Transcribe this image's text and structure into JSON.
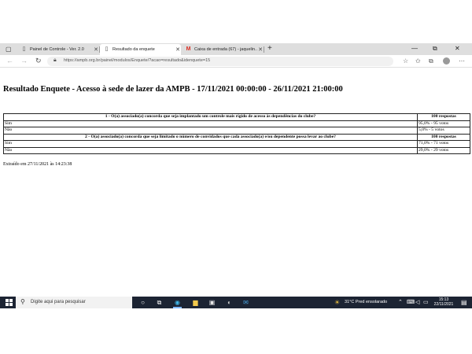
{
  "browser": {
    "tabs": [
      {
        "title": "Painel de Controle - Ver. 2.0",
        "icon": "page-icon"
      },
      {
        "title": "Resultado da enquete",
        "icon": "page-icon"
      },
      {
        "title": "Caixa de entrada (67) - jaquelin...",
        "icon": "gmail-icon"
      }
    ],
    "new_tab": "+",
    "url": "https://ampb.org.br/painel/modulos/Enquete/?acao=resultado&idenquete=15"
  },
  "page": {
    "title": "Resultado Enquete - Acesso à sede de lazer da AMPB - 17/11/2021 00:00:00 - 26/11/2021 21:00:00",
    "questions": [
      {
        "question": "1 - O(a) associado(a) concorda que seja implantado um controle mais rígido de acesso às dependências do clube?",
        "responses": "100 respostas",
        "options": [
          {
            "label": "Sim",
            "value": "95,0% - 95 votos"
          },
          {
            "label": "Não",
            "value": "5,0% - 5 votos"
          }
        ]
      },
      {
        "question": "2 - O(a) associado(a) concorda que seja limitado o número de convidados que cada associado(a) e/ou dependente possa levar ao clube?",
        "responses": "100 respostas",
        "options": [
          {
            "label": "Sim",
            "value": "71,0% - 71 votos"
          },
          {
            "label": "Não",
            "value": "29,0% - 29 votos"
          }
        ]
      }
    ],
    "extracted": "Extraído em 27/11/2021 às 14:23:38"
  },
  "taskbar": {
    "search_placeholder": "Digite aqui para pesquisar",
    "weather": "31°C  Pred ensolarado",
    "time": "15:13",
    "date": "22/11/2021"
  },
  "colors": {
    "taskbar": "#1c2433",
    "tabstrip": "#dedede"
  }
}
